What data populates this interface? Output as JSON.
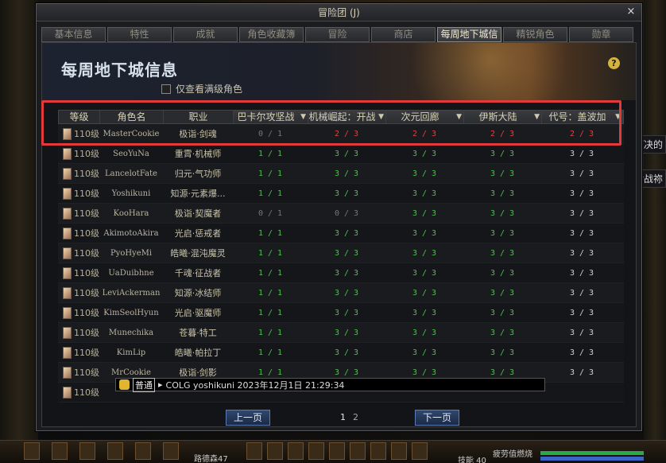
{
  "window": {
    "title": "冒险团 (J)",
    "close": "×"
  },
  "tabs": [
    "基本信息",
    "特性",
    "成就",
    "角色收藏簿",
    "冒险",
    "商店",
    "每周地下城信息",
    "精锐角色",
    "勋章"
  ],
  "active_tab": 6,
  "page_title": "每周地下城信息",
  "help": "?",
  "filter_label": "仅查看满级角色",
  "columns": [
    "等级",
    "角色名",
    "职业",
    "巴卡尔攻坚战",
    "机械崛起：开战",
    "次元回廊",
    "伊斯大陆",
    "代号：盖波加"
  ],
  "rows": [
    {
      "level": "110级",
      "name": "MasterCookie",
      "job": "极诣·剑魂",
      "d": [
        "0 / 1",
        "2 / 3",
        "2 / 3",
        "2 / 3",
        "2 / 3"
      ],
      "c": [
        "gray",
        "red",
        "red",
        "red",
        "red"
      ]
    },
    {
      "level": "110级",
      "name": "SeoYuNa",
      "job": "重霄·机械师",
      "d": [
        "1 / 1",
        "3 / 3",
        "3 / 3",
        "3 / 3",
        "3 / 3"
      ],
      "c": [
        "green",
        "green",
        "green",
        "green",
        "white"
      ]
    },
    {
      "level": "110级",
      "name": "LancelotFate",
      "job": "归元·气功师",
      "d": [
        "1 / 1",
        "3 / 3",
        "3 / 3",
        "3 / 3",
        "3 / 3"
      ],
      "c": [
        "green",
        "green",
        "green",
        "green",
        "white"
      ]
    },
    {
      "level": "110级",
      "name": "Yoshikuni",
      "job": "知源·元素爆...",
      "d": [
        "1 / 1",
        "3 / 3",
        "3 / 3",
        "3 / 3",
        "3 / 3"
      ],
      "c": [
        "green",
        "green",
        "green",
        "green",
        "white"
      ]
    },
    {
      "level": "110级",
      "name": "KooHara",
      "job": "极诣·契魔者",
      "d": [
        "0 / 1",
        "0 / 3",
        "3 / 3",
        "3 / 3",
        "3 / 3"
      ],
      "c": [
        "gray",
        "gray",
        "green",
        "green",
        "white"
      ]
    },
    {
      "level": "110级",
      "name": "AkimotoAkira",
      "job": "光启·惩戒者",
      "d": [
        "1 / 1",
        "3 / 3",
        "3 / 3",
        "3 / 3",
        "3 / 3"
      ],
      "c": [
        "green",
        "green",
        "green",
        "green",
        "white"
      ]
    },
    {
      "level": "110级",
      "name": "PyoHyeMi",
      "job": "皓曦·混沌魔灵",
      "d": [
        "1 / 1",
        "3 / 3",
        "3 / 3",
        "3 / 3",
        "3 / 3"
      ],
      "c": [
        "green",
        "green",
        "green",
        "green",
        "white"
      ]
    },
    {
      "level": "110级",
      "name": "UaDuibhne",
      "job": "千魂·征战者",
      "d": [
        "1 / 1",
        "3 / 3",
        "3 / 3",
        "3 / 3",
        "3 / 3"
      ],
      "c": [
        "green",
        "green",
        "green",
        "green",
        "white"
      ]
    },
    {
      "level": "110级",
      "name": "LeviAckerman",
      "job": "知源·冰结师",
      "d": [
        "1 / 1",
        "3 / 3",
        "3 / 3",
        "3 / 3",
        "3 / 3"
      ],
      "c": [
        "green",
        "green",
        "green",
        "green",
        "white"
      ]
    },
    {
      "level": "110级",
      "name": "KimSeolHyun",
      "job": "光启·驱魔师",
      "d": [
        "1 / 1",
        "3 / 3",
        "3 / 3",
        "3 / 3",
        "3 / 3"
      ],
      "c": [
        "green",
        "green",
        "green",
        "green",
        "white"
      ]
    },
    {
      "level": "110级",
      "name": "Munechika",
      "job": "苍暮·特工",
      "d": [
        "1 / 1",
        "3 / 3",
        "3 / 3",
        "3 / 3",
        "3 / 3"
      ],
      "c": [
        "green",
        "green",
        "green",
        "green",
        "white"
      ]
    },
    {
      "level": "110级",
      "name": "KimLip",
      "job": "皓曦·帕拉丁",
      "d": [
        "1 / 1",
        "3 / 3",
        "3 / 3",
        "3 / 3",
        "3 / 3"
      ],
      "c": [
        "green",
        "green",
        "green",
        "green",
        "white"
      ]
    },
    {
      "level": "110级",
      "name": "MrCookie",
      "job": "极诣·剑影",
      "d": [
        "1 / 1",
        "3 / 3",
        "3 / 3",
        "3 / 3",
        "3 / 3"
      ],
      "c": [
        "green",
        "green",
        "green",
        "green",
        "white"
      ]
    },
    {
      "level": "110级",
      "name": "",
      "job": "",
      "d": [
        "",
        "",
        "",
        "",
        ""
      ],
      "c": [
        "green",
        "green",
        "green",
        "green",
        "white"
      ]
    }
  ],
  "chat": {
    "channel": "普通",
    "text": "COLG yoshikuni 2023年12月1日 21:29:34"
  },
  "pager": {
    "prev": "上一页",
    "next": "下一页",
    "pages": [
      "1",
      "2"
    ],
    "current": "1"
  },
  "side_labels": [
    "下决的",
    "七战祢"
  ],
  "hud": {
    "level_text": "路德森47",
    "skill_text": "技能 40",
    "status_text": "疲劳值燃烧"
  }
}
